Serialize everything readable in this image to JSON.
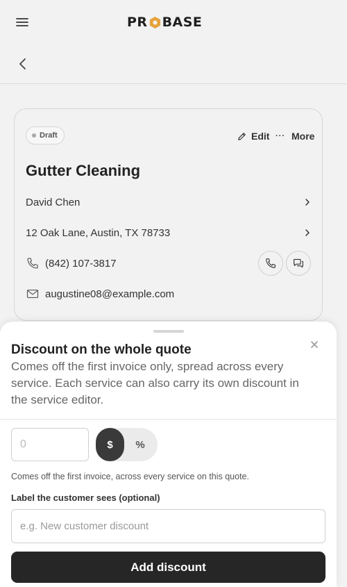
{
  "app": {
    "logo_text_before": "PR",
    "logo_text_after": "BASE",
    "accent_color": "#e6a23c"
  },
  "quote": {
    "status": "Draft",
    "edit_label": "Edit",
    "more_label": "More",
    "title": "Gutter Cleaning",
    "customer_name": "David Chen",
    "address": "12 Oak Lane, Austin, TX 78733",
    "phone": "(842) 107-3817",
    "email": "augustine08@example.com"
  },
  "discount_sheet": {
    "title": "Discount on the whole quote",
    "description": "Comes off the first invoice only, spread across every service. Each service can also carry its own discount in the service editor.",
    "amount_placeholder": "0",
    "type_options": [
      "$",
      "%"
    ],
    "selected_type": "$",
    "helper_text": "Comes off the first invoice, across every service on this quote.",
    "label_field_label": "Label the customer sees (optional)",
    "label_field_placeholder": "e.g. New customer discount",
    "submit_label": "Add discount"
  }
}
